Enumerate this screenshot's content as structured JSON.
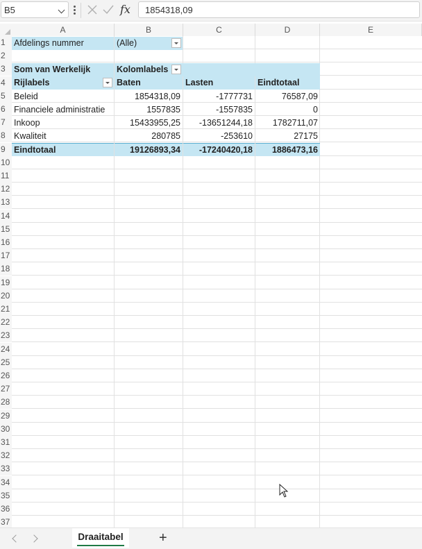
{
  "formula_bar": {
    "name_box": "B5",
    "fx_label": "fx",
    "formula_value": "1854318,09"
  },
  "columns": [
    "A",
    "B",
    "C",
    "D",
    "E"
  ],
  "rows": [
    "1",
    "2",
    "3",
    "4",
    "5",
    "6",
    "7",
    "8",
    "9",
    "10",
    "11",
    "12",
    "13",
    "14",
    "15",
    "16",
    "17",
    "18",
    "19",
    "20",
    "21",
    "22",
    "23",
    "24",
    "25",
    "26",
    "27",
    "28",
    "29",
    "30",
    "31",
    "32",
    "33",
    "34",
    "35",
    "36",
    "37"
  ],
  "pivot": {
    "filter_label": "Afdelings nummer",
    "filter_value": "(Alle)",
    "values_header": "Som van Werkelijk",
    "column_labels": "Kolomlabels",
    "row_labels": "Rijlabels",
    "col_headers": [
      "Baten",
      "Lasten",
      "Eindtotaal"
    ],
    "rows": [
      {
        "label": "Beleid",
        "baten": "1854318,09",
        "lasten": "-1777731",
        "total": "76587,09"
      },
      {
        "label": "Financiele administratie",
        "baten": "1557835",
        "lasten": "-1557835",
        "total": "0"
      },
      {
        "label": "Inkoop",
        "baten": "15433955,25",
        "lasten": "-13651244,18",
        "total": "1782711,07"
      },
      {
        "label": "Kwaliteit",
        "baten": "280785",
        "lasten": "-253610",
        "total": "27175"
      }
    ],
    "grand_total": {
      "label": "Eindtotaal",
      "baten": "19126893,34",
      "lasten": "-17240420,18",
      "total": "1886473,16"
    }
  },
  "sheet_tabs": {
    "active": "Draaitabel",
    "add_label": "+"
  },
  "colors": {
    "pivot_header": "#c5e6f3",
    "selection": "#1f7a45"
  }
}
